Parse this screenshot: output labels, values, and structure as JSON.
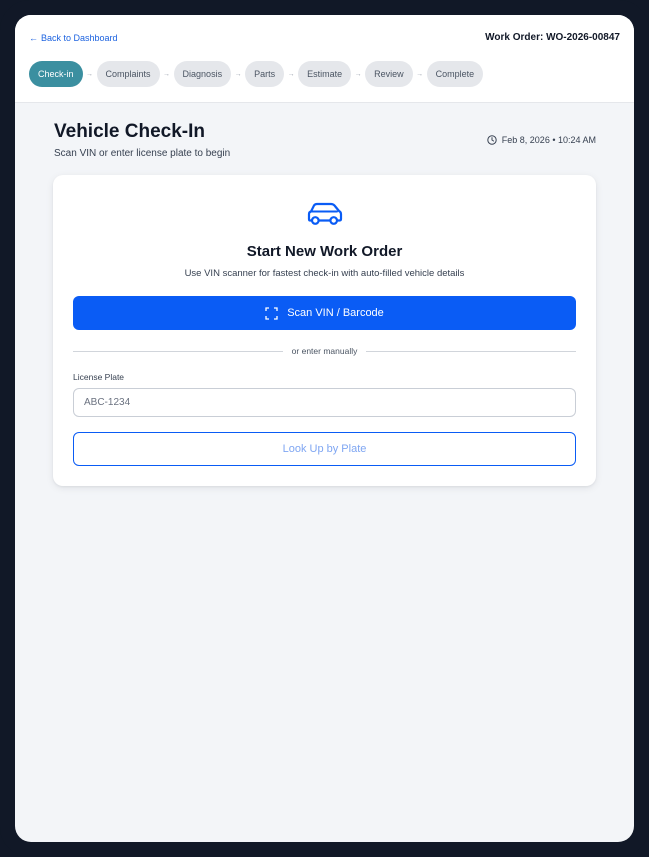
{
  "header": {
    "back_label": "Back to Dashboard",
    "work_order_label": "Work Order: WO-2026-00847"
  },
  "steps": [
    {
      "label": "Check-in",
      "active": true
    },
    {
      "label": "Complaints",
      "active": false
    },
    {
      "label": "Diagnosis",
      "active": false
    },
    {
      "label": "Parts",
      "active": false
    },
    {
      "label": "Estimate",
      "active": false
    },
    {
      "label": "Review",
      "active": false
    },
    {
      "label": "Complete",
      "active": false
    }
  ],
  "page": {
    "title": "Vehicle Check-In",
    "subtitle": "Scan VIN or enter license plate to begin",
    "timestamp": "Feb 8, 2026 • 10:24 AM"
  },
  "card": {
    "icon": "car-icon",
    "title": "Start New Work Order",
    "description": "Use VIN scanner for fastest check-in with auto-filled vehicle details",
    "scan_button_label": "Scan VIN / Barcode",
    "divider_text": "or enter manually",
    "plate_label": "License Plate",
    "plate_value": "",
    "plate_placeholder": "ABC-1234",
    "lookup_button_label": "Look Up by Plate"
  },
  "colors": {
    "primary": "#0a5cf5",
    "step_active": "#3b8fa0",
    "link": "#1d63e0"
  }
}
